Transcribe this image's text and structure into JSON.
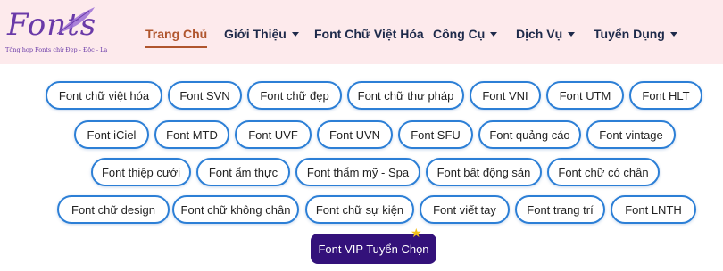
{
  "logo": {
    "text": "Fonts",
    "tagline": "Tổng hợp Fonts chữ Đẹp - Độc - Lạ"
  },
  "nav": {
    "items": [
      {
        "label": "Trang Chủ",
        "active": true,
        "dropdown": false
      },
      {
        "label": "Giới Thiệu",
        "active": false,
        "dropdown": true
      },
      {
        "label": "Font Chữ Việt Hóa",
        "active": false,
        "dropdown": false
      },
      {
        "label": "Công Cụ",
        "active": false,
        "dropdown": true
      },
      {
        "label": "Dịch Vụ",
        "active": false,
        "dropdown": true
      },
      {
        "label": "Tuyển Dụng",
        "active": false,
        "dropdown": true
      }
    ]
  },
  "tags": {
    "rows": [
      [
        "Font chữ việt hóa",
        "Font SVN",
        "Font chữ đẹp",
        "Font chữ thư pháp",
        "Font VNI",
        "Font UTM",
        "Font HLT"
      ],
      [
        "Font iCiel",
        "Font MTD",
        "Font UVF",
        "Font UVN",
        "Font SFU",
        "Font quảng cáo",
        "Font vintage"
      ],
      [
        "Font thiệp cưới",
        "Font ẩm thực",
        "Font thẩm mỹ - Spa",
        "Font bất động sản",
        "Font chữ có chân"
      ],
      [
        "Font chữ design",
        "Font chữ không chân",
        "Font chữ sự kiện",
        "Font viết tay",
        "Font trang trí",
        "Font LNTH"
      ]
    ]
  },
  "vip_button": {
    "label": "Font VIP Tuyển Chọn"
  },
  "colors": {
    "header_bg": "#fdeaec",
    "active": "#b0552d",
    "tag_border": "#2c7fd6",
    "vip_bg": "#33117a",
    "star": "#f3c21a"
  }
}
